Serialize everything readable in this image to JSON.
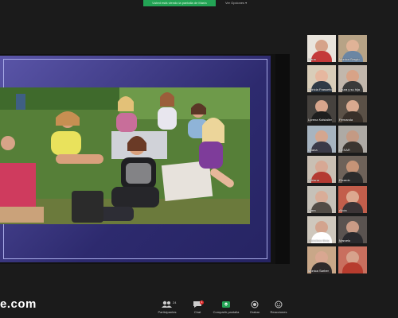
{
  "banner": {
    "share_text": "Usted está viendo la pantalla de María",
    "view_options": "Ver Opciones"
  },
  "watermark": "e.com",
  "gallery": {
    "participants": [
      {
        "name": "Ivana",
        "bg": "#e9e4dc",
        "skin": "#d6a38a",
        "shirt": "#c43a3a"
      },
      {
        "name": "Monica Sergio",
        "bg": "#b7a386",
        "skin": "#e0b397",
        "shirt": "#6b86a3"
      },
      {
        "name": "patricia Frassetto",
        "bg": "#d9cdb9",
        "skin": "#e6b79f",
        "shirt": "#2f3a46"
      },
      {
        "name": "Laura y su hija",
        "bg": "#c2b7ac",
        "skin": "#d8a387",
        "shirt": "#3a3a3a"
      },
      {
        "name": "Lorena Kalstaller",
        "bg": "#46423e",
        "skin": "#d7a58c",
        "shirt": "#1e1e1e"
      },
      {
        "name": "Fernanda",
        "bg": "#5b5147",
        "skin": "#d8a98f",
        "shirt": "#38302a"
      },
      {
        "name": "Liliana",
        "bg": "#a7b4c0",
        "skin": "#d4a68f",
        "shirt": "#3a3a48"
      },
      {
        "name": "CESAR",
        "bg": "#aeaaa5",
        "skin": "#c49a84",
        "shirt": "#3b3530"
      },
      {
        "name": "Adriana",
        "bg": "#c9bfb3",
        "skin": "#d7a894",
        "shirt": "#b43a32"
      },
      {
        "name": "Ricardo",
        "bg": "#6e6259",
        "skin": "#c69477",
        "shirt": "#2c2c2c"
      },
      {
        "name": "Clara",
        "bg": "#c6c1b8",
        "skin": "#d9ad98",
        "shirt": "#524c46"
      },
      {
        "name": "Alicia",
        "bg": "#c35e4b",
        "skin": "#dca88f",
        "shirt": "#3c3436"
      },
      {
        "name": "Francisco Bory",
        "bg": "#cfc8bd",
        "skin": "#d3a48e",
        "shirt": "#ffffff"
      },
      {
        "name": "Marcelo",
        "bg": "#5a5350",
        "skin": "#c99b86",
        "shirt": "#2a2a2e"
      },
      {
        "name": "Monica Sarber",
        "bg": "#c9a788",
        "skin": "#d9a791",
        "shirt": "#2f2a2a"
      },
      {
        "name": "",
        "bg": "#c96f5e",
        "skin": "#d7a28c",
        "shirt": "#b73c2e"
      }
    ]
  },
  "toolbar": {
    "participants_label": "Participantes",
    "participants_count": "24",
    "chat_label": "Chat",
    "chat_badge": "1",
    "share_label": "Compartir pantalla",
    "record_label": "Grabar",
    "reactions_label": "Reacciones"
  },
  "colors": {
    "share_green": "#23a455",
    "slide_purple": "#2d2a6e"
  }
}
